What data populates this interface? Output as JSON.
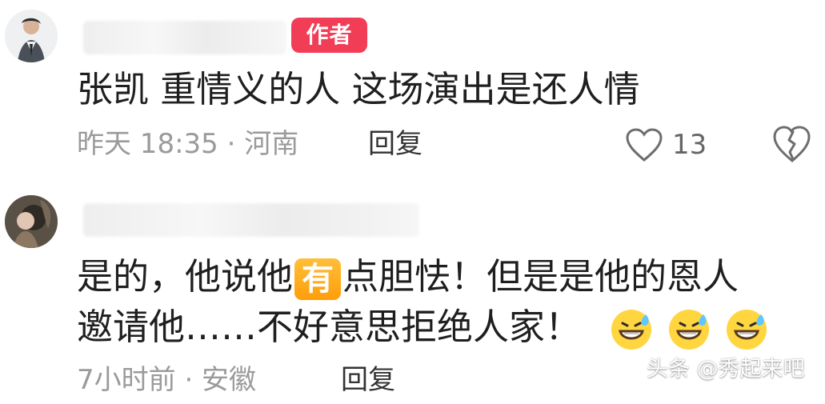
{
  "comments": [
    {
      "author_badge": "作者",
      "text": "张凯 重情义的人 这场演出是还人情",
      "meta": "昨天 18:35 · 河南",
      "reply": "回复",
      "like_count": "13"
    },
    {
      "text_prefix": "是的，他说他",
      "ai_tag": "有",
      "text_suffix": "点胆怯！但是是他的恩人",
      "text_line2": "邀请他……不好意思拒绝人家！",
      "meta": "7小时前 · 安徽",
      "reply": "回复"
    }
  ],
  "watermark": "头条 @秀起来吧",
  "colors": {
    "author_badge": "#f23d56",
    "ai_tag": "#ff9d0a",
    "meta": "#9a9a9a",
    "text": "#1f1f1f"
  },
  "icons": {
    "like": "heart-outline-icon",
    "dislike": "broken-heart-icon",
    "emoji": "grinning-sweat-emoji-icon"
  }
}
